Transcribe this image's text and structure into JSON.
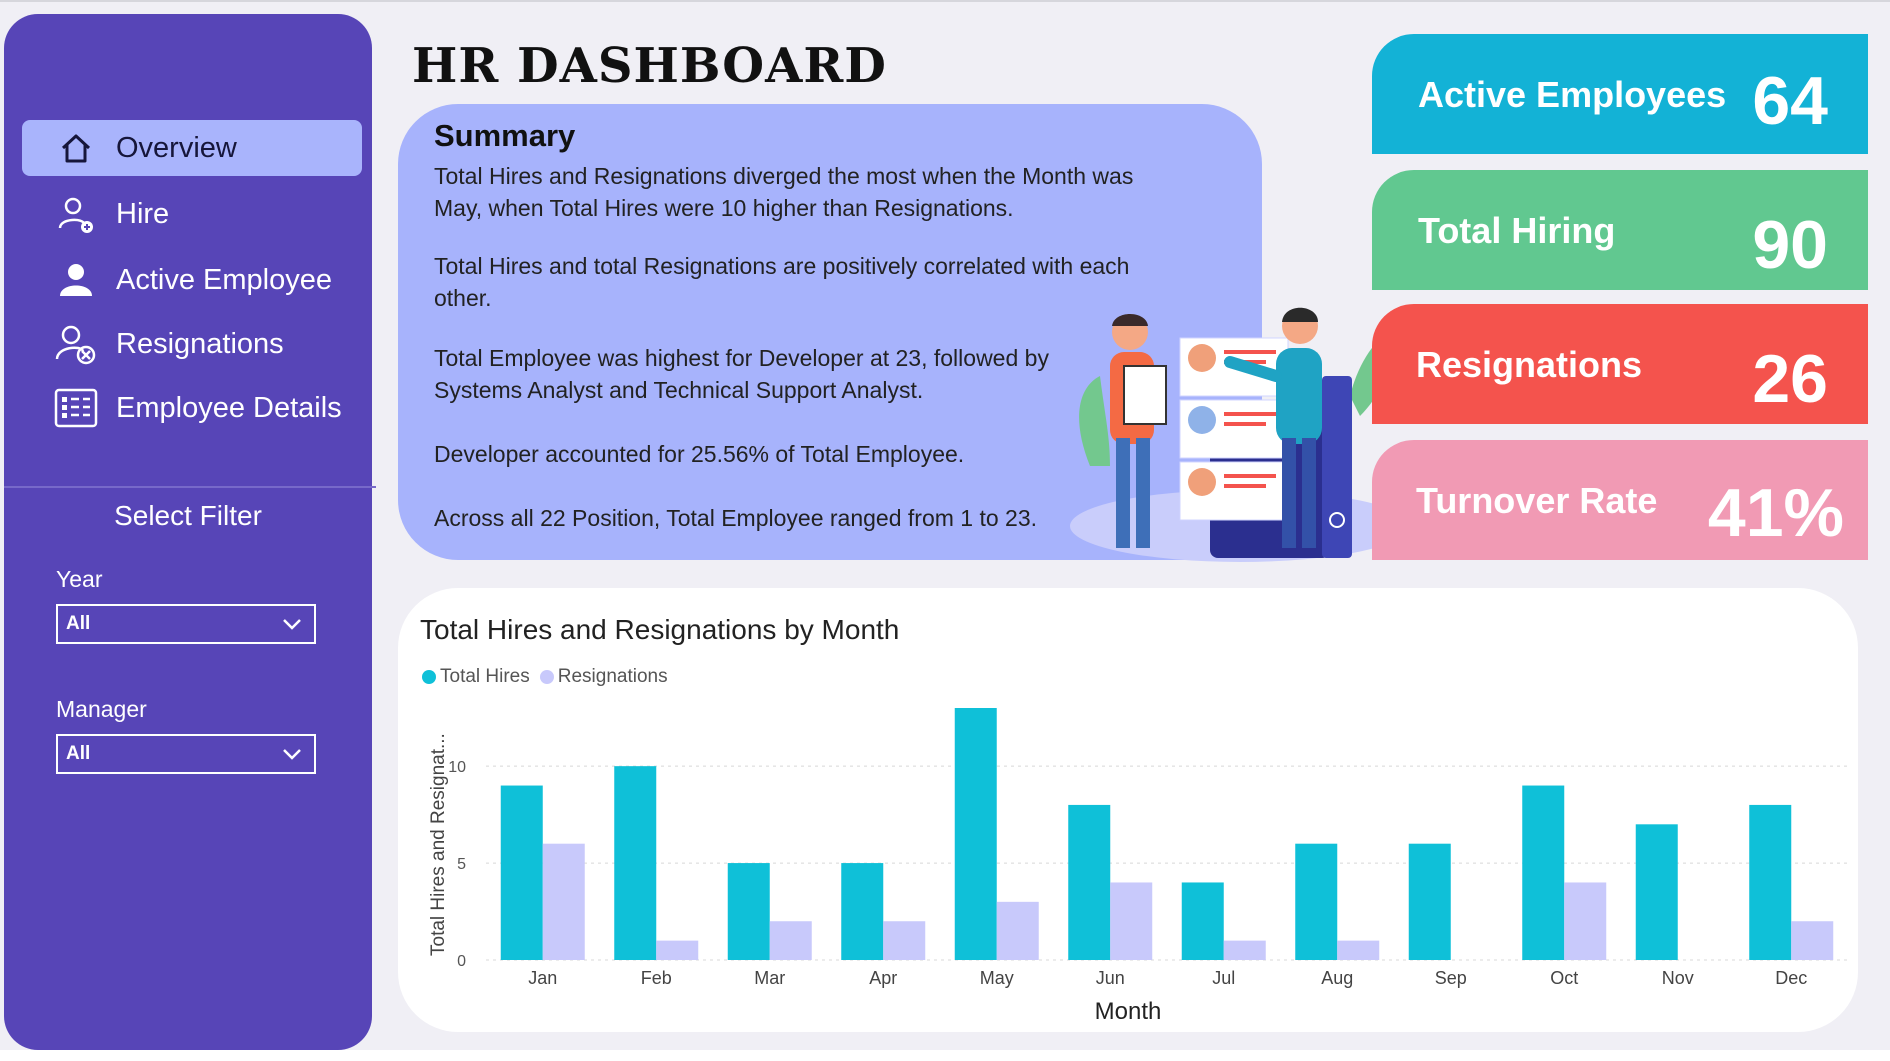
{
  "header": {
    "title": "HR DASHBOARD"
  },
  "sidebar": {
    "items": [
      {
        "label": "Overview",
        "icon": "home-icon",
        "active": true
      },
      {
        "label": "Hire",
        "icon": "add-user-icon",
        "active": false
      },
      {
        "label": "Active Employee",
        "icon": "user-icon",
        "active": false
      },
      {
        "label": "Resignations",
        "icon": "remove-user-icon",
        "active": false
      },
      {
        "label": "Employee Details",
        "icon": "details-list-icon",
        "active": false
      }
    ],
    "filter_title": "Select Filter",
    "filters": {
      "year": {
        "label": "Year",
        "value": "All"
      },
      "manager": {
        "label": "Manager",
        "value": "All"
      }
    }
  },
  "summary": {
    "heading": "Summary",
    "paragraphs": [
      "Total Hires and Resignations diverged the most when the Month was May, when Total Hires were 10 higher than Resignations.",
      "Total Hires and total Resignations are positively correlated with each other.",
      "Total Employee was highest for Developer at 23, followed by Systems Analyst and Technical Support Analyst.",
      "Developer accounted for 25.56% of Total Employee.",
      "Across all 22 Position, Total Employee ranged from 1 to 23."
    ]
  },
  "kpis": [
    {
      "label": "Active Employees",
      "value": "64",
      "color": "#13b2d6"
    },
    {
      "label": "Total Hiring",
      "value": "90",
      "color": "#61c890"
    },
    {
      "label": "Resignations",
      "value": "26",
      "color": "#f4534d"
    },
    {
      "label": "Turnover Rate",
      "value": "41%",
      "color": "#f19ab4"
    }
  ],
  "colors": {
    "sidebar": "#5745b7",
    "summary": "#a7b3fc",
    "hires": "#0fc0d8",
    "resignations": "#c8c9fb"
  },
  "chart_data": {
    "type": "bar",
    "title": "Total Hires and Resignations by Month",
    "xlabel": "Month",
    "ylabel": "Total Hires and Resignat...",
    "categories": [
      "Jan",
      "Feb",
      "Mar",
      "Apr",
      "May",
      "Jun",
      "Jul",
      "Aug",
      "Sep",
      "Oct",
      "Nov",
      "Dec"
    ],
    "series": [
      {
        "name": "Total Hires",
        "values": [
          9,
          10,
          5,
          5,
          13,
          8,
          4,
          6,
          6,
          9,
          7,
          8
        ]
      },
      {
        "name": "Resignations",
        "values": [
          6,
          1,
          2,
          2,
          3,
          4,
          1,
          1,
          0,
          4,
          0,
          2
        ]
      }
    ],
    "yticks": [
      0,
      5,
      10
    ],
    "ylim": [
      0,
      13
    ],
    "grid": true,
    "legend": "top-left"
  }
}
